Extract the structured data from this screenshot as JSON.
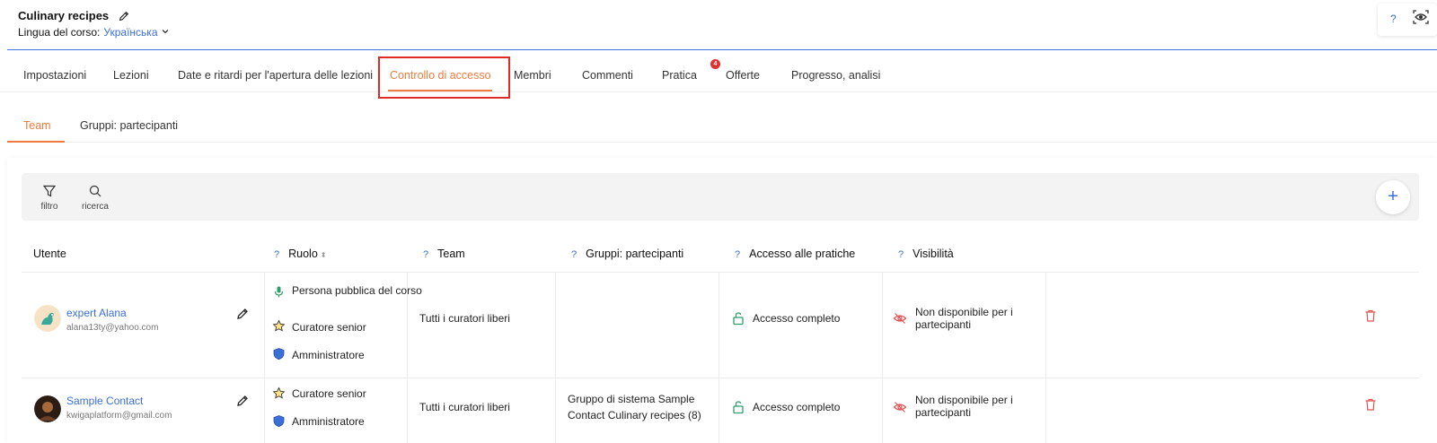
{
  "header": {
    "course_title": "Culinary recipes",
    "language_label": "Lingua del corso:",
    "language_value": "Українська",
    "help_label": "?"
  },
  "tabs": [
    {
      "label": "Impostazioni"
    },
    {
      "label": "Lezioni"
    },
    {
      "label": "Date e ritardi per l'apertura delle lezioni"
    },
    {
      "label": "Controllo di accesso",
      "active": true
    },
    {
      "label": "Membri"
    },
    {
      "label": "Commenti"
    },
    {
      "label": "Pratica",
      "badge": "4"
    },
    {
      "label": "Offerte"
    },
    {
      "label": "Progresso, analisi"
    }
  ],
  "subtabs": [
    {
      "label": "Team",
      "active": true
    },
    {
      "label": "Gruppi: partecipanti"
    }
  ],
  "toolbar": {
    "filter_label": "filtro",
    "search_label": "ricerca",
    "add_label": "+"
  },
  "table": {
    "columns": {
      "user": "Utente",
      "role": "Ruolo",
      "team": "Team",
      "groups": "Gruppi: partecipanti",
      "access": "Accesso alle pratiche",
      "visibility": "Visibilità"
    },
    "help_mark": "?",
    "sort_mark": "⬍",
    "rows": [
      {
        "name": "expert Alana",
        "email": "alana13ty@yahoo.com",
        "roles": [
          "Persona pubblica del corso",
          "Curatore senior",
          "Amministratore"
        ],
        "team": "Tutti i curatori liberi",
        "groups": "",
        "access": "Accesso completo",
        "visibility": "Non disponibile per i partecipanti"
      },
      {
        "name": "Sample Contact",
        "email": "kwigaplatform@gmail.com",
        "roles": [
          "Curatore senior",
          "Amministratore"
        ],
        "team": "Tutti i curatori liberi",
        "groups": "Gruppo di sistema Sample Contact Culinary recipes (8)",
        "access": "Accesso completo",
        "visibility": "Non disponibile per i partecipanti"
      }
    ]
  },
  "colors": {
    "accent": "#f07b3f",
    "link": "#3b6fd8",
    "highlight": "#e02a2a",
    "access_green": "#2e9e6a",
    "danger": "#e05555"
  }
}
